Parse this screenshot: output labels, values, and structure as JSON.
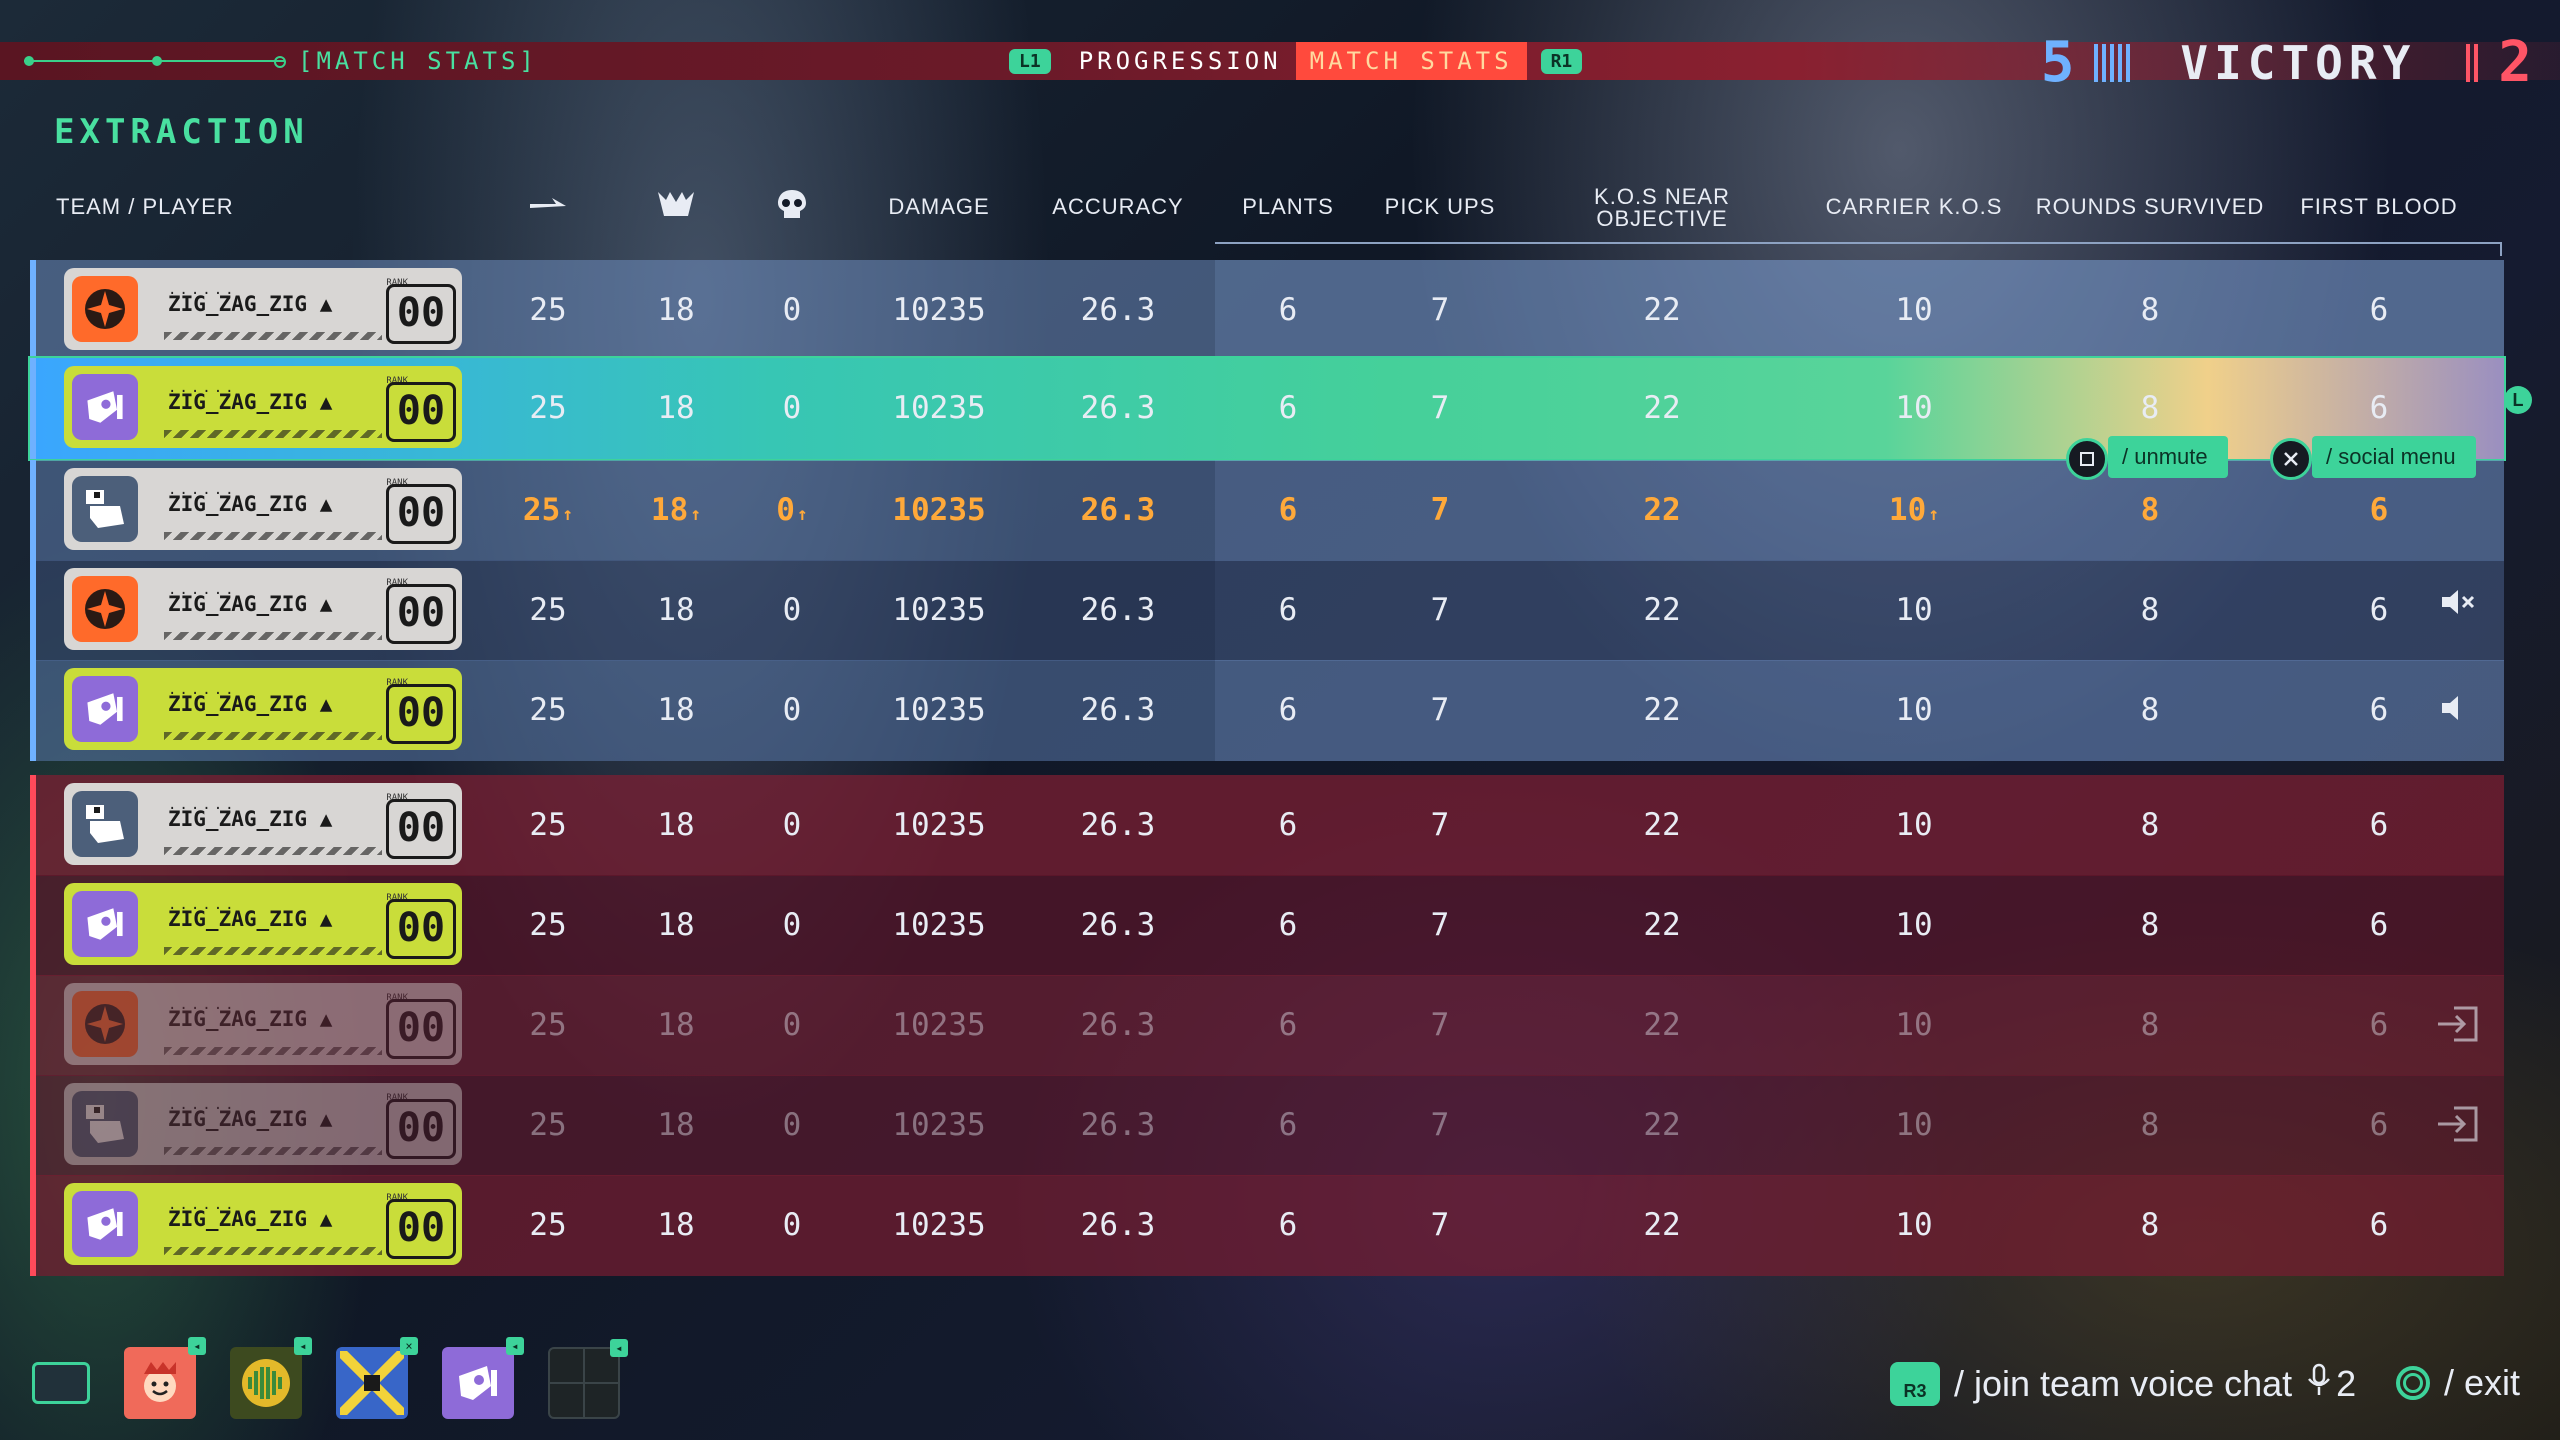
{
  "topbar": {
    "crumb": "[MATCH STATS]",
    "l1": "L1",
    "r1": "R1",
    "tab_progression": "PROGRESSION",
    "tab_match_stats": "MATCH STATS",
    "score_left": "5",
    "result": "VICTORY",
    "score_right": "2",
    "colors": {
      "accent": "#3dd39a",
      "active_tab": "#ff4a3d",
      "team_blue": "#6fb1ff",
      "team_red": "#ff5566",
      "highlight": "#ffa93a"
    }
  },
  "mode": "EXTRACTION",
  "columns": {
    "team_player": "TEAM / PLAYER",
    "c1_icon": "dash-icon",
    "c2_icon": "crown-icon",
    "c3_icon": "skull-icon",
    "damage": "DAMAGE",
    "accuracy": "ACCURACY",
    "plants": "PLANTS",
    "pickups": "PICK UPS",
    "kos_near_1": "K.O.S NEAR",
    "kos_near_2": "OBJECTIVE",
    "carrier": "CARRIER K.O.S",
    "rounds": "ROUNDS SURVIVED",
    "first_blood": "FIRST BLOOD"
  },
  "rows": [
    {
      "name": "ZIG_ZAG_ZIG",
      "dots": "......",
      "rk": "RANK",
      "rank": "00",
      "icon": "crosshair-icon",
      "v": [
        "25",
        "18",
        "0",
        "10235",
        "26.3",
        "6",
        "7",
        "22",
        "10",
        "8",
        "6"
      ]
    },
    {
      "name": "ZIG_ZAG_ZIG",
      "dots": "......",
      "rk": "RANK",
      "rank": "00",
      "icon": "robot-icon",
      "v": [
        "25",
        "18",
        "0",
        "10235",
        "26.3",
        "6",
        "7",
        "22",
        "10",
        "8",
        "6"
      ]
    },
    {
      "name": "ZIG_ZAG_ZIG",
      "dots": "......",
      "rk": "RANK",
      "rank": "00",
      "icon": "mech-icon",
      "v": [
        "25",
        "18",
        "0",
        "10235",
        "26.3",
        "6",
        "7",
        "22",
        "10",
        "8",
        "6"
      ]
    },
    {
      "name": "ZIG_ZAG_ZIG",
      "dots": "......",
      "rk": "RANK",
      "rank": "00",
      "icon": "crosshair-icon",
      "v": [
        "25",
        "18",
        "0",
        "10235",
        "26.3",
        "6",
        "7",
        "22",
        "10",
        "8",
        "6"
      ]
    },
    {
      "name": "ZIG_ZAG_ZIG",
      "dots": "......",
      "rk": "RANK",
      "rank": "00",
      "icon": "robot-icon",
      "v": [
        "25",
        "18",
        "0",
        "10235",
        "26.3",
        "6",
        "7",
        "22",
        "10",
        "8",
        "6"
      ]
    },
    {
      "name": "ZIG_ZAG_ZIG",
      "dots": "......",
      "rk": "RANK",
      "rank": "00",
      "icon": "mech-icon",
      "v": [
        "25",
        "18",
        "0",
        "10235",
        "26.3",
        "6",
        "7",
        "22",
        "10",
        "8",
        "6"
      ]
    },
    {
      "name": "ZIG_ZAG_ZIG",
      "dots": "......",
      "rk": "RANK",
      "rank": "00",
      "icon": "robot-icon",
      "v": [
        "25",
        "18",
        "0",
        "10235",
        "26.3",
        "6",
        "7",
        "22",
        "10",
        "8",
        "6"
      ]
    },
    {
      "name": "ZIG_ZAG_ZIG",
      "dots": "......",
      "rk": "RANK",
      "rank": "00",
      "icon": "crosshair-icon",
      "v": [
        "25",
        "18",
        "0",
        "10235",
        "26.3",
        "6",
        "7",
        "22",
        "10",
        "8",
        "6"
      ]
    },
    {
      "name": "ZIG_ZAG_ZIG",
      "dots": "......",
      "rk": "RANK",
      "rank": "00",
      "icon": "mech-icon",
      "v": [
        "25",
        "18",
        "0",
        "10235",
        "26.3",
        "6",
        "7",
        "22",
        "10",
        "8",
        "6"
      ]
    },
    {
      "name": "ZIG_ZAG_ZIG",
      "dots": "......",
      "rk": "RANK",
      "rank": "00",
      "icon": "robot-icon",
      "v": [
        "25",
        "18",
        "0",
        "10235",
        "26.3",
        "6",
        "7",
        "22",
        "10",
        "8",
        "6"
      ]
    }
  ],
  "tooltip": {
    "unmute": "/ unmute",
    "social": "/ social menu",
    "l_stick": "L"
  },
  "footer": {
    "r3": "R3",
    "join_voice": "/ join team voice chat",
    "mic_count": "2",
    "exit": "/ exit"
  }
}
